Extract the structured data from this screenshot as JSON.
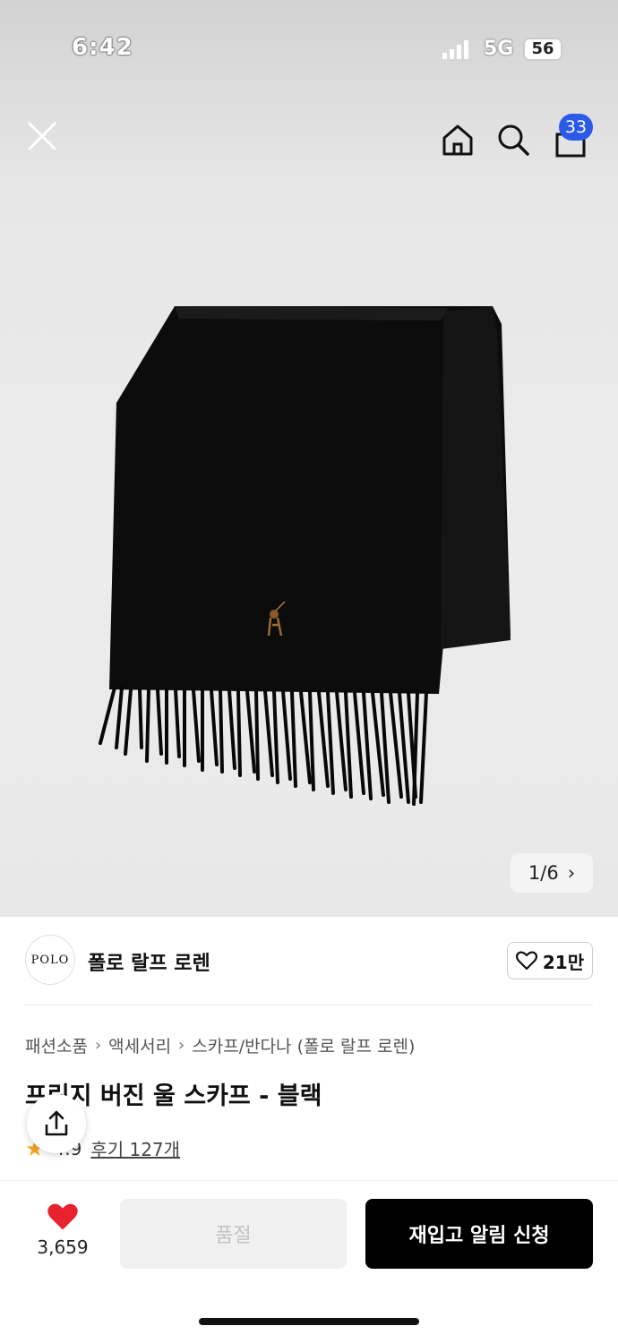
{
  "status": {
    "time": "6:42",
    "network": "5G",
    "battery": "56"
  },
  "nav": {
    "cart_count": "33"
  },
  "gallery": {
    "current": "1",
    "separator": "/",
    "total": "6"
  },
  "brand": {
    "logo_text": "POLO",
    "name": "폴로 랄프 로렌",
    "likes": "21만"
  },
  "breadcrumb": [
    "패션소품",
    "액세서리",
    "스카프/반다나 (폴로 랄프 로렌)"
  ],
  "product": {
    "title": "프린지 버진 울 스카프 - 블랙",
    "rating": "4.9",
    "reviews": "후기 127개"
  },
  "bottom": {
    "wish_count": "3,659",
    "soldout_label": "품절",
    "restock_label": "재입고 알림 신청"
  },
  "colors": {
    "badge": "#2b59e8",
    "heart": "#e8232f",
    "primary_button": "#000000"
  }
}
